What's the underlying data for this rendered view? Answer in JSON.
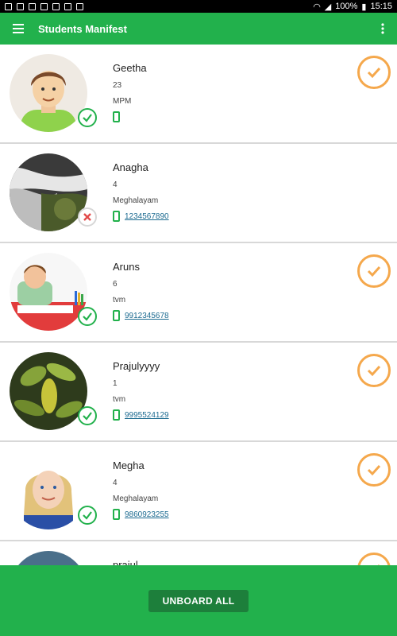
{
  "statusbar": {
    "battery": "100%",
    "time": "15:15"
  },
  "appbar": {
    "title": "Students Manifest"
  },
  "students": [
    {
      "name": "Geetha",
      "age": "23",
      "place": "MPM",
      "phone": "",
      "status": "ok",
      "boarded": true
    },
    {
      "name": "Anagha",
      "age": "4",
      "place": "Meghalayam",
      "phone": "1234567890",
      "status": "no",
      "boarded": false
    },
    {
      "name": "Aruns",
      "age": "6",
      "place": "tvm",
      "phone": "9912345678",
      "status": "ok",
      "boarded": true
    },
    {
      "name": "Prajulyyyy",
      "age": "1",
      "place": "tvm",
      "phone": "9995524129",
      "status": "ok",
      "boarded": true
    },
    {
      "name": "Megha",
      "age": "4",
      "place": "Meghalayam",
      "phone": "9860923255",
      "status": "ok",
      "boarded": true
    },
    {
      "name": "prajul",
      "age": "",
      "place": "",
      "phone": "",
      "status": "",
      "boarded": true
    }
  ],
  "actions": {
    "unboard_all": "UNBOARD ALL"
  }
}
